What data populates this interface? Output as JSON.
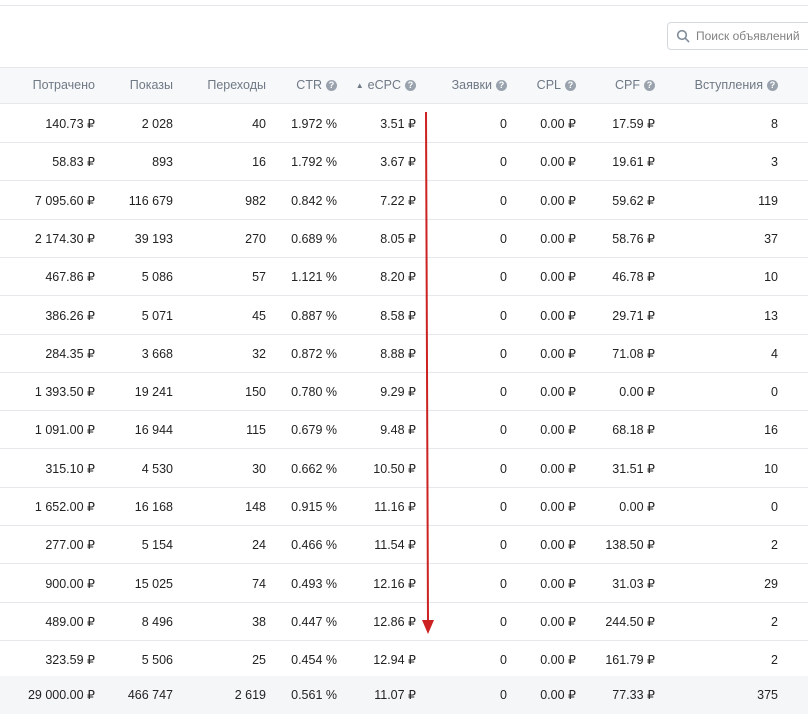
{
  "search": {
    "placeholder": "Поиск объявлений"
  },
  "columns": [
    {
      "label": "Потрачено",
      "help": false
    },
    {
      "label": "Показы",
      "help": false
    },
    {
      "label": "Переходы",
      "help": false
    },
    {
      "label": "CTR",
      "help": true
    },
    {
      "label": "eCPC",
      "help": true,
      "sorted": "asc"
    },
    {
      "label": "Заявки",
      "help": true
    },
    {
      "label": "CPL",
      "help": true
    },
    {
      "label": "CPF",
      "help": true
    },
    {
      "label": "Вступления",
      "help": true
    }
  ],
  "rows": [
    [
      "140.73 ₽",
      "2 028",
      "40",
      "1.972 %",
      "3.51 ₽",
      "0",
      "0.00 ₽",
      "17.59 ₽",
      "8"
    ],
    [
      "58.83 ₽",
      "893",
      "16",
      "1.792 %",
      "3.67 ₽",
      "0",
      "0.00 ₽",
      "19.61 ₽",
      "3"
    ],
    [
      "7 095.60 ₽",
      "116 679",
      "982",
      "0.842 %",
      "7.22 ₽",
      "0",
      "0.00 ₽",
      "59.62 ₽",
      "119"
    ],
    [
      "2 174.30 ₽",
      "39 193",
      "270",
      "0.689 %",
      "8.05 ₽",
      "0",
      "0.00 ₽",
      "58.76 ₽",
      "37"
    ],
    [
      "467.86 ₽",
      "5 086",
      "57",
      "1.121 %",
      "8.20 ₽",
      "0",
      "0.00 ₽",
      "46.78 ₽",
      "10"
    ],
    [
      "386.26 ₽",
      "5 071",
      "45",
      "0.887 %",
      "8.58 ₽",
      "0",
      "0.00 ₽",
      "29.71 ₽",
      "13"
    ],
    [
      "284.35 ₽",
      "3 668",
      "32",
      "0.872 %",
      "8.88 ₽",
      "0",
      "0.00 ₽",
      "71.08 ₽",
      "4"
    ],
    [
      "1 393.50 ₽",
      "19 241",
      "150",
      "0.780 %",
      "9.29 ₽",
      "0",
      "0.00 ₽",
      "0.00 ₽",
      "0"
    ],
    [
      "1 091.00 ₽",
      "16 944",
      "115",
      "0.679 %",
      "9.48 ₽",
      "0",
      "0.00 ₽",
      "68.18 ₽",
      "16"
    ],
    [
      "315.10 ₽",
      "4 530",
      "30",
      "0.662 %",
      "10.50 ₽",
      "0",
      "0.00 ₽",
      "31.51 ₽",
      "10"
    ],
    [
      "1 652.00 ₽",
      "16 168",
      "148",
      "0.915 %",
      "11.16 ₽",
      "0",
      "0.00 ₽",
      "0.00 ₽",
      "0"
    ],
    [
      "277.00 ₽",
      "5 154",
      "24",
      "0.466 %",
      "11.54 ₽",
      "0",
      "0.00 ₽",
      "138.50 ₽",
      "2"
    ],
    [
      "900.00 ₽",
      "15 025",
      "74",
      "0.493 %",
      "12.16 ₽",
      "0",
      "0.00 ₽",
      "31.03 ₽",
      "29"
    ],
    [
      "489.00 ₽",
      "8 496",
      "38",
      "0.447 %",
      "12.86 ₽",
      "0",
      "0.00 ₽",
      "244.50 ₽",
      "2"
    ],
    [
      "323.59 ₽",
      "5 506",
      "25",
      "0.454 %",
      "12.94 ₽",
      "0",
      "0.00 ₽",
      "161.79 ₽",
      "2"
    ]
  ],
  "total": [
    "29 000.00 ₽",
    "466 747",
    "2 619",
    "0.561 %",
    "11.07 ₽",
    "0",
    "0.00 ₽",
    "77.33 ₽",
    "375"
  ],
  "colors": {
    "annotation_arrow": "#cc2222",
    "header_bg": "#f7f8fa",
    "border": "#e7e8ec"
  }
}
